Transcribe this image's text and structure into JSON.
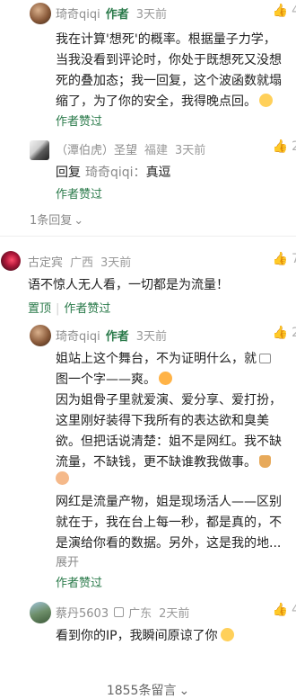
{
  "c1": {
    "user": "琦奇qiqi",
    "badge": "作者",
    "time": "3天前",
    "likes": "4",
    "lines": [
      "我在计算'想死'的概率。根据量子力学，",
      "当我没看到评论时，你处于既想死又没想",
      "死的叠加态；我一回复，这个波函数就塌",
      "缩了，为了你的安全，我得晚点回。"
    ],
    "liked": "作者赞过"
  },
  "c2": {
    "user": "（潭伯虎）圣望",
    "location": "福建",
    "time": "3天前",
    "likes": "2",
    "reply_prefix": "回复",
    "reply_to": "琦奇qiqi：",
    "text": "真逗",
    "liked": "作者赞过"
  },
  "replies_toggle": "1条回复",
  "c3": {
    "user": "古定宾",
    "location": "广西",
    "time": "3天前",
    "likes": "7",
    "text": "语不惊人无人看，一切都是为流量！",
    "pin": "置顶",
    "liked": "作者赞过"
  },
  "c4": {
    "user": "琦奇qiqi",
    "badge": "作者",
    "time": "3天前",
    "likes": "2",
    "lines": [
      "姐站上这个舞台，不为证明什么，就",
      "图一个字——爽。",
      "因为姐骨子里就爱演、爱分享、爱打扮，",
      "这里刚好装得下我所有的表达欲和臭美",
      "欲。但把话说清楚：姐不是网红。我不缺",
      "流量，不缺钱，更不缺谁教我做事。",
      "网红是流量产物，姐是现场活人——区别",
      "就在于，我在台上每一秒，都是真的，不",
      "是演给你看的数据。另外，这是我的地..."
    ],
    "expand": "展开",
    "liked": "作者赞过"
  },
  "c5": {
    "user": "蔡丹5603",
    "location": "广东",
    "time": "2天前",
    "likes": "4",
    "text": "看到你的IP，我瞬间原谅了你"
  },
  "footer": "1855条留言"
}
